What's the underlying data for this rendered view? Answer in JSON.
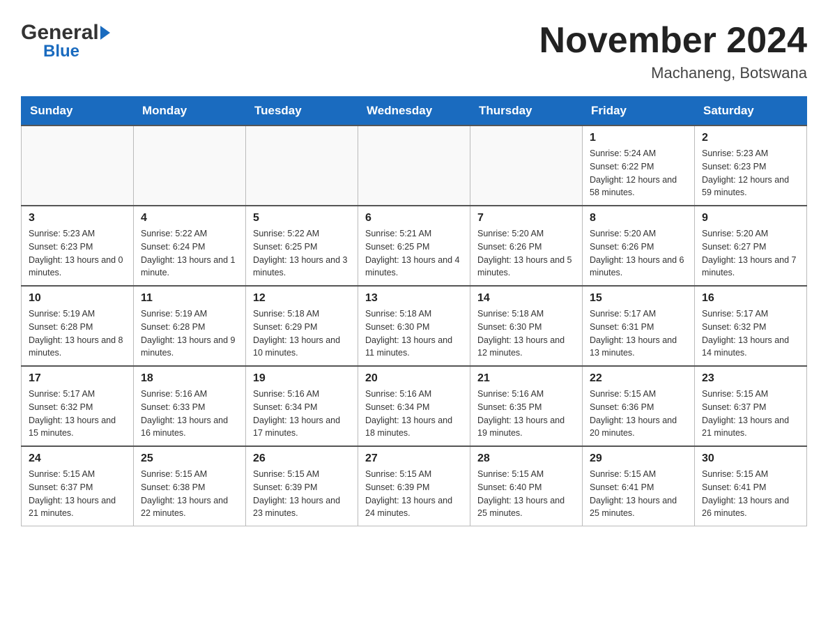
{
  "header": {
    "logo_general": "General",
    "logo_blue": "Blue",
    "month_title": "November 2024",
    "location": "Machaneng, Botswana"
  },
  "days_of_week": [
    "Sunday",
    "Monday",
    "Tuesday",
    "Wednesday",
    "Thursday",
    "Friday",
    "Saturday"
  ],
  "weeks": [
    [
      {
        "day": "",
        "info": ""
      },
      {
        "day": "",
        "info": ""
      },
      {
        "day": "",
        "info": ""
      },
      {
        "day": "",
        "info": ""
      },
      {
        "day": "",
        "info": ""
      },
      {
        "day": "1",
        "info": "Sunrise: 5:24 AM\nSunset: 6:22 PM\nDaylight: 12 hours\nand 58 minutes."
      },
      {
        "day": "2",
        "info": "Sunrise: 5:23 AM\nSunset: 6:23 PM\nDaylight: 12 hours\nand 59 minutes."
      }
    ],
    [
      {
        "day": "3",
        "info": "Sunrise: 5:23 AM\nSunset: 6:23 PM\nDaylight: 13 hours\nand 0 minutes."
      },
      {
        "day": "4",
        "info": "Sunrise: 5:22 AM\nSunset: 6:24 PM\nDaylight: 13 hours\nand 1 minute."
      },
      {
        "day": "5",
        "info": "Sunrise: 5:22 AM\nSunset: 6:25 PM\nDaylight: 13 hours\nand 3 minutes."
      },
      {
        "day": "6",
        "info": "Sunrise: 5:21 AM\nSunset: 6:25 PM\nDaylight: 13 hours\nand 4 minutes."
      },
      {
        "day": "7",
        "info": "Sunrise: 5:20 AM\nSunset: 6:26 PM\nDaylight: 13 hours\nand 5 minutes."
      },
      {
        "day": "8",
        "info": "Sunrise: 5:20 AM\nSunset: 6:26 PM\nDaylight: 13 hours\nand 6 minutes."
      },
      {
        "day": "9",
        "info": "Sunrise: 5:20 AM\nSunset: 6:27 PM\nDaylight: 13 hours\nand 7 minutes."
      }
    ],
    [
      {
        "day": "10",
        "info": "Sunrise: 5:19 AM\nSunset: 6:28 PM\nDaylight: 13 hours\nand 8 minutes."
      },
      {
        "day": "11",
        "info": "Sunrise: 5:19 AM\nSunset: 6:28 PM\nDaylight: 13 hours\nand 9 minutes."
      },
      {
        "day": "12",
        "info": "Sunrise: 5:18 AM\nSunset: 6:29 PM\nDaylight: 13 hours\nand 10 minutes."
      },
      {
        "day": "13",
        "info": "Sunrise: 5:18 AM\nSunset: 6:30 PM\nDaylight: 13 hours\nand 11 minutes."
      },
      {
        "day": "14",
        "info": "Sunrise: 5:18 AM\nSunset: 6:30 PM\nDaylight: 13 hours\nand 12 minutes."
      },
      {
        "day": "15",
        "info": "Sunrise: 5:17 AM\nSunset: 6:31 PM\nDaylight: 13 hours\nand 13 minutes."
      },
      {
        "day": "16",
        "info": "Sunrise: 5:17 AM\nSunset: 6:32 PM\nDaylight: 13 hours\nand 14 minutes."
      }
    ],
    [
      {
        "day": "17",
        "info": "Sunrise: 5:17 AM\nSunset: 6:32 PM\nDaylight: 13 hours\nand 15 minutes."
      },
      {
        "day": "18",
        "info": "Sunrise: 5:16 AM\nSunset: 6:33 PM\nDaylight: 13 hours\nand 16 minutes."
      },
      {
        "day": "19",
        "info": "Sunrise: 5:16 AM\nSunset: 6:34 PM\nDaylight: 13 hours\nand 17 minutes."
      },
      {
        "day": "20",
        "info": "Sunrise: 5:16 AM\nSunset: 6:34 PM\nDaylight: 13 hours\nand 18 minutes."
      },
      {
        "day": "21",
        "info": "Sunrise: 5:16 AM\nSunset: 6:35 PM\nDaylight: 13 hours\nand 19 minutes."
      },
      {
        "day": "22",
        "info": "Sunrise: 5:15 AM\nSunset: 6:36 PM\nDaylight: 13 hours\nand 20 minutes."
      },
      {
        "day": "23",
        "info": "Sunrise: 5:15 AM\nSunset: 6:37 PM\nDaylight: 13 hours\nand 21 minutes."
      }
    ],
    [
      {
        "day": "24",
        "info": "Sunrise: 5:15 AM\nSunset: 6:37 PM\nDaylight: 13 hours\nand 21 minutes."
      },
      {
        "day": "25",
        "info": "Sunrise: 5:15 AM\nSunset: 6:38 PM\nDaylight: 13 hours\nand 22 minutes."
      },
      {
        "day": "26",
        "info": "Sunrise: 5:15 AM\nSunset: 6:39 PM\nDaylight: 13 hours\nand 23 minutes."
      },
      {
        "day": "27",
        "info": "Sunrise: 5:15 AM\nSunset: 6:39 PM\nDaylight: 13 hours\nand 24 minutes."
      },
      {
        "day": "28",
        "info": "Sunrise: 5:15 AM\nSunset: 6:40 PM\nDaylight: 13 hours\nand 25 minutes."
      },
      {
        "day": "29",
        "info": "Sunrise: 5:15 AM\nSunset: 6:41 PM\nDaylight: 13 hours\nand 25 minutes."
      },
      {
        "day": "30",
        "info": "Sunrise: 5:15 AM\nSunset: 6:41 PM\nDaylight: 13 hours\nand 26 minutes."
      }
    ]
  ]
}
